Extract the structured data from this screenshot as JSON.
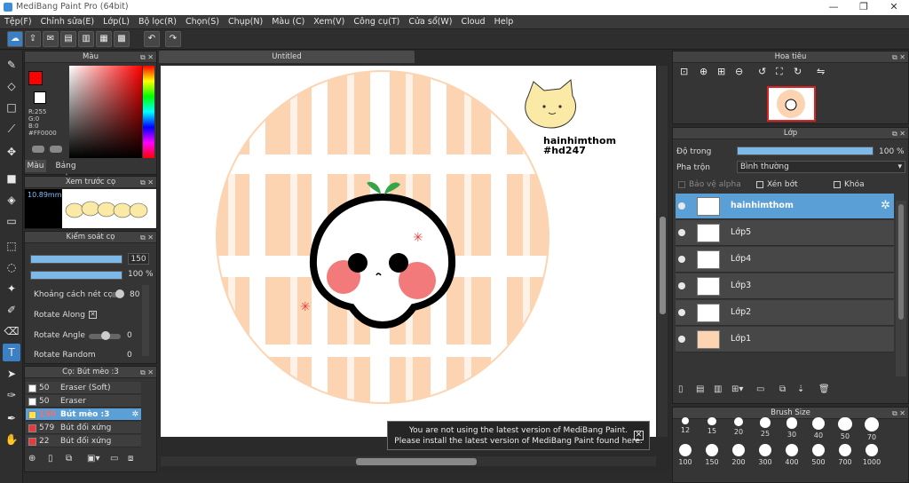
{
  "window": {
    "title": "MediBang Paint Pro (64bit)",
    "min": "—",
    "max": "❐",
    "close": "✕"
  },
  "menu": [
    "Tệp(F)",
    "Chỉnh sửa(E)",
    "Lớp(L)",
    "Bộ lọc(R)",
    "Chọn(S)",
    "Chụp(N)",
    "Màu (C)",
    "Xem(V)",
    "Công cụ(T)",
    "Cửa sổ(W)",
    "Cloud",
    "Help"
  ],
  "color_panel": {
    "title": "Màu",
    "readout_r": "R:255",
    "readout_g": "G:0",
    "readout_b": "B:0",
    "hex": "#FF0000",
    "tab_color": "Màu",
    "tab_palette": "Bảng màu",
    "primary_color": "#ff0000"
  },
  "brush_preview": {
    "title": "Xem trước cọ",
    "size": "10.89mm"
  },
  "brush_control": {
    "title": "Kiểm soát cọ",
    "size_value": "150",
    "opacity_value": "100 %",
    "spacing_label": "Khoảng cách nét cọ",
    "spacing_value": "80",
    "rotate_along_label": "Rotate Along",
    "rotate_angle_label": "Rotate Angle",
    "rotate_angle_value": "0",
    "rotate_random_label": "Rotate Random",
    "rotate_random_value": "0"
  },
  "brush_list": {
    "title": "Cọ: Bút mèo :3",
    "items": [
      {
        "size": "50",
        "name": "Eraser (Soft)",
        "color": "#ffffff"
      },
      {
        "size": "50",
        "name": "Eraser",
        "color": "#ffffff"
      },
      {
        "size": "150",
        "name": "Bút mèo :3",
        "color": "#ffe14a"
      },
      {
        "size": "579",
        "name": "Bút đối xứng",
        "color": "#e83a3a"
      },
      {
        "size": "22",
        "name": "Bút đối xứng",
        "color": "#e83a3a"
      }
    ]
  },
  "document": {
    "tab": "Untitled",
    "signature_line1": "hainhimthom",
    "signature_line2": "#hd247"
  },
  "notice": {
    "line1": "You are not using the latest version of MediBang Paint.",
    "line2": "Please install the latest version of MediBang Paint found here.",
    "close": "✕"
  },
  "navigator": {
    "title": "Hoa tiêu"
  },
  "layers": {
    "title": "Lớp",
    "opacity_label": "Độ trong",
    "opacity_value": "100 %",
    "blend_label": "Pha trộn",
    "blend_value": "Bình thường",
    "protect_alpha": "Bảo vệ alpha",
    "clipping": "Xén bớt",
    "lock": "Khóa",
    "items": [
      {
        "name": "hainhimthom",
        "selected": true
      },
      {
        "name": "Lớp5",
        "selected": false
      },
      {
        "name": "Lớp4",
        "selected": false
      },
      {
        "name": "Lớp3",
        "selected": false
      },
      {
        "name": "Lớp2",
        "selected": false
      },
      {
        "name": "Lớp1",
        "selected": false
      }
    ]
  },
  "brush_size": {
    "title": "Brush Size",
    "row1": [
      "12",
      "15",
      "20",
      "25",
      "30",
      "40",
      "50",
      "70"
    ],
    "row2": [
      "100",
      "150",
      "200",
      "300",
      "400",
      "500",
      "700",
      "1000"
    ]
  }
}
